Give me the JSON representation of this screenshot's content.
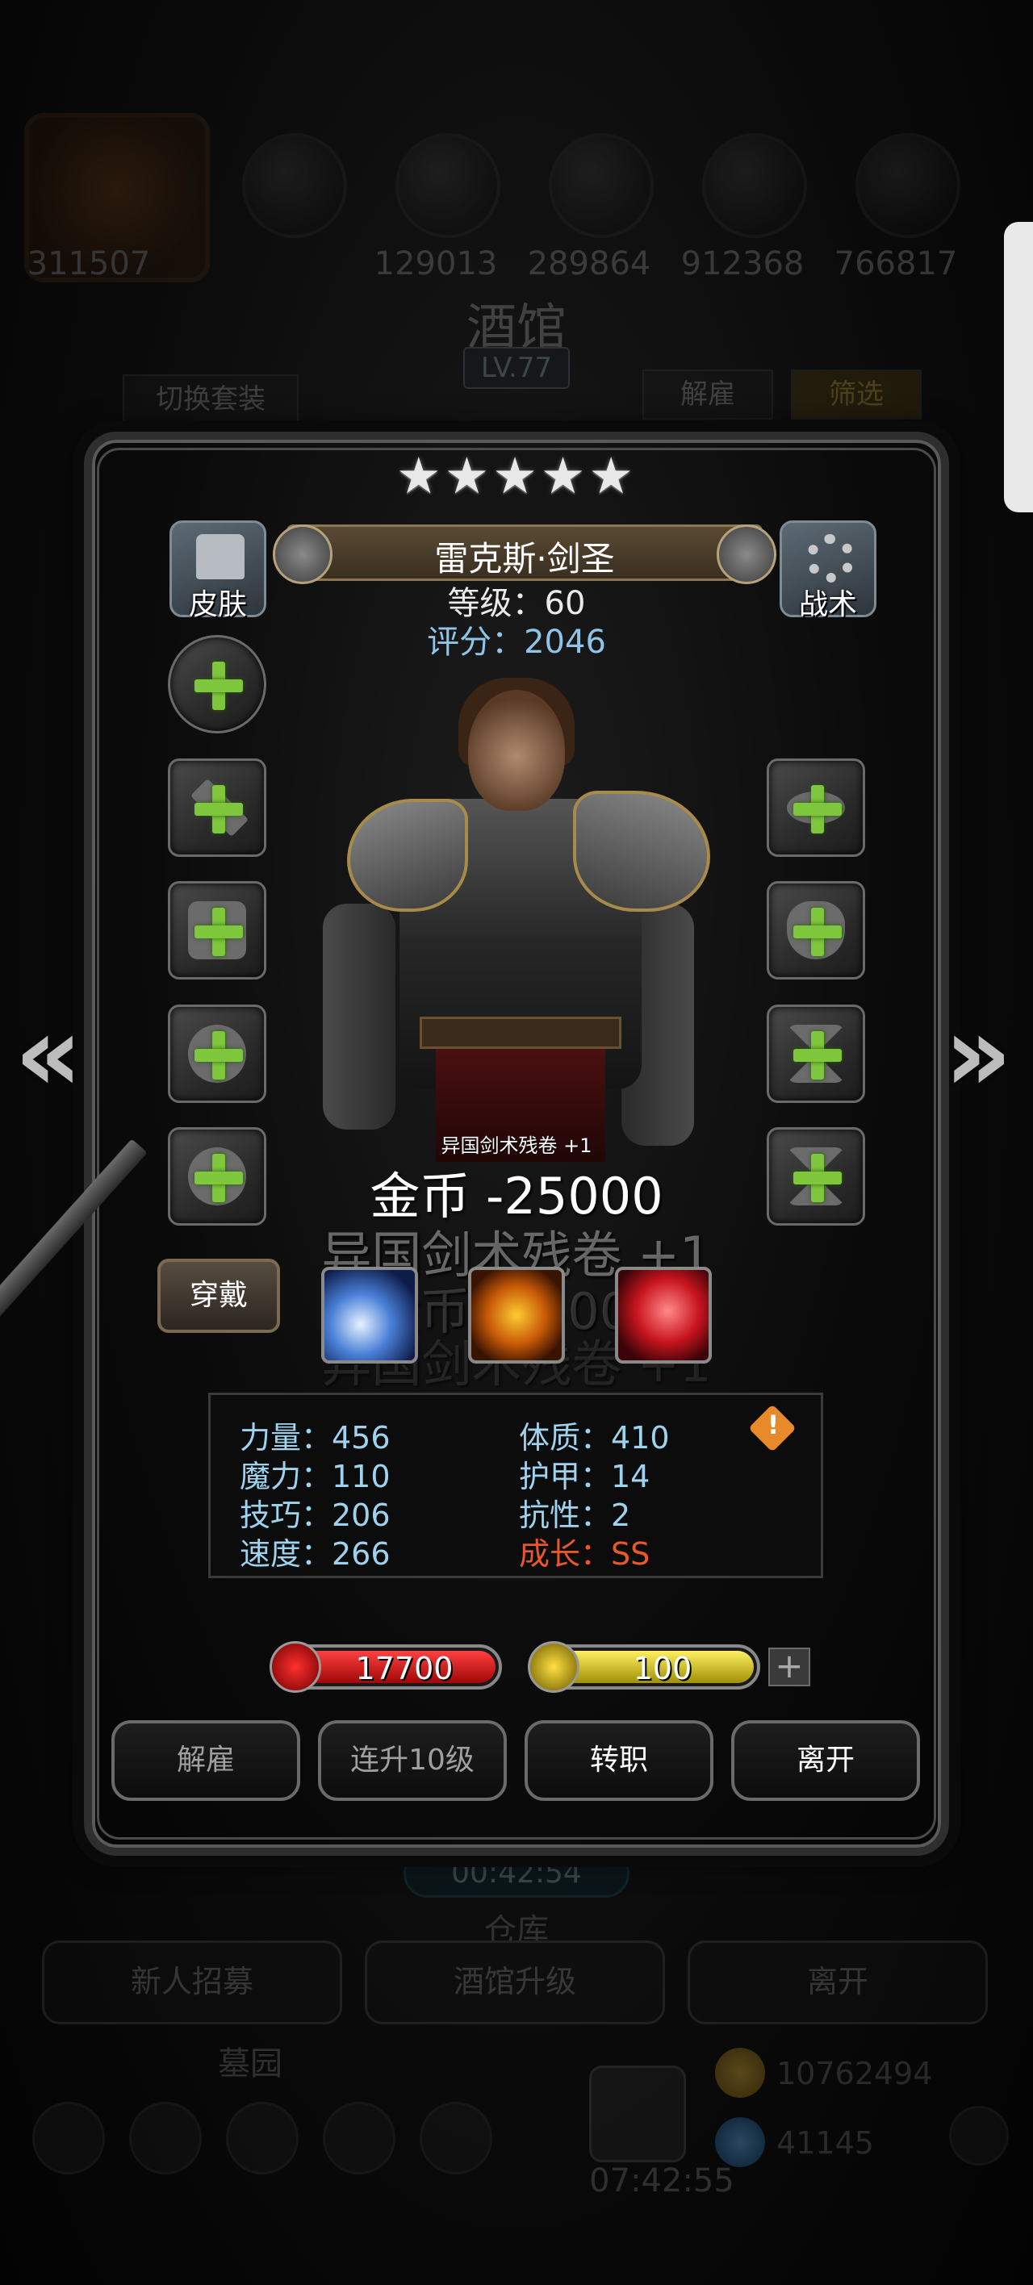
{
  "background": {
    "resource_values": [
      "311507",
      "129013",
      "289864",
      "912368",
      "766817"
    ],
    "title": "酒馆",
    "level": "LV.77",
    "switch_set_label": "切换套装",
    "dismiss_label": "解雇",
    "filter_label": "筛选",
    "timer": "00:42:54",
    "warehouse_label": "仓库",
    "recruit_label": "新人招募",
    "upgrade_tavern_label": "酒馆升级",
    "leave_label": "离开",
    "cemetery_label": "墓园",
    "gift_timer": "07:42:55",
    "gold_amount": "10762494",
    "gem_amount": "41145"
  },
  "hero": {
    "stars": "★★★★★",
    "name": "雷克斯·剑圣",
    "level_text": "等级：60",
    "score_text": "评分：2046",
    "skin_label": "皮肤",
    "tactics_label": "战术",
    "wear_label": "穿戴"
  },
  "floating": {
    "small": "异国剑术残卷 +1",
    "gold_change": "金币 -25000",
    "item_gain": "异国剑术残卷 +1",
    "gold_change_ghost": "金币 -25000",
    "item_gain_ghost": "异国剑术残卷 +1"
  },
  "stats": {
    "strength": "力量：456",
    "constitution": "体质：410",
    "magic": "魔力：110",
    "armor": "护甲：14",
    "skill": "技巧：206",
    "resistance": "抗性：2",
    "speed": "速度：266",
    "growth": "成长：SS"
  },
  "bars": {
    "hp": "17700",
    "energy": "100"
  },
  "actions": {
    "dismiss": "解雇",
    "level_up_10": "连升10级",
    "change_class": "转职",
    "leave": "离开"
  },
  "colors": {
    "accent_green": "#7ec63c",
    "stat_blue": "#9fd2ee",
    "growth_orange": "#e8582a",
    "hp_red": "#d01818",
    "energy_yellow": "#e8d420"
  }
}
